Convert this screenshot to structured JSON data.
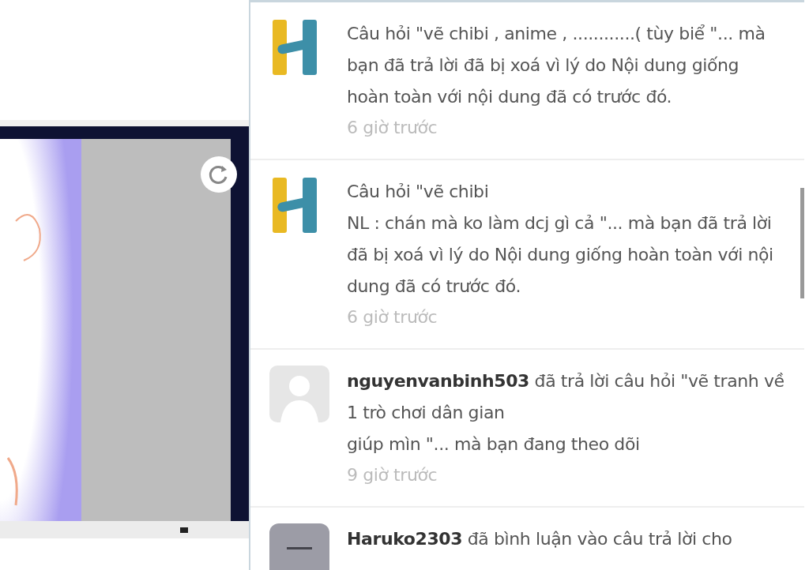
{
  "notifications": [
    {
      "kind": "logo",
      "text": "Câu hỏi \"vẽ chibi , anime , ............( tùy biể \"... mà bạn đã trả lời đã bị xoá vì lý do Nội dung giống hoàn toàn với nội dung đã có trước đó.",
      "time": "6 giờ trước"
    },
    {
      "kind": "logo",
      "text": "Câu hỏi \"vẽ chibi\nNL : chán mà ko làm dcj gì cả  \"... mà bạn đã trả lời đã bị xoá vì lý do Nội dung giống hoàn toàn với nội dung đã có trước đó.",
      "time": "6 giờ trước"
    },
    {
      "kind": "silhouette",
      "text": "**nguyenvanbinh503** đã trả lời câu hỏi \"vẽ tranh về 1 trò chơi dân gian\ngiúp mìn \"... mà bạn đang theo dõi",
      "time": "9 giờ trước"
    },
    {
      "kind": "picture",
      "text": "**Haruko2303** đã bình luận vào câu trả lời cho"
    }
  ]
}
